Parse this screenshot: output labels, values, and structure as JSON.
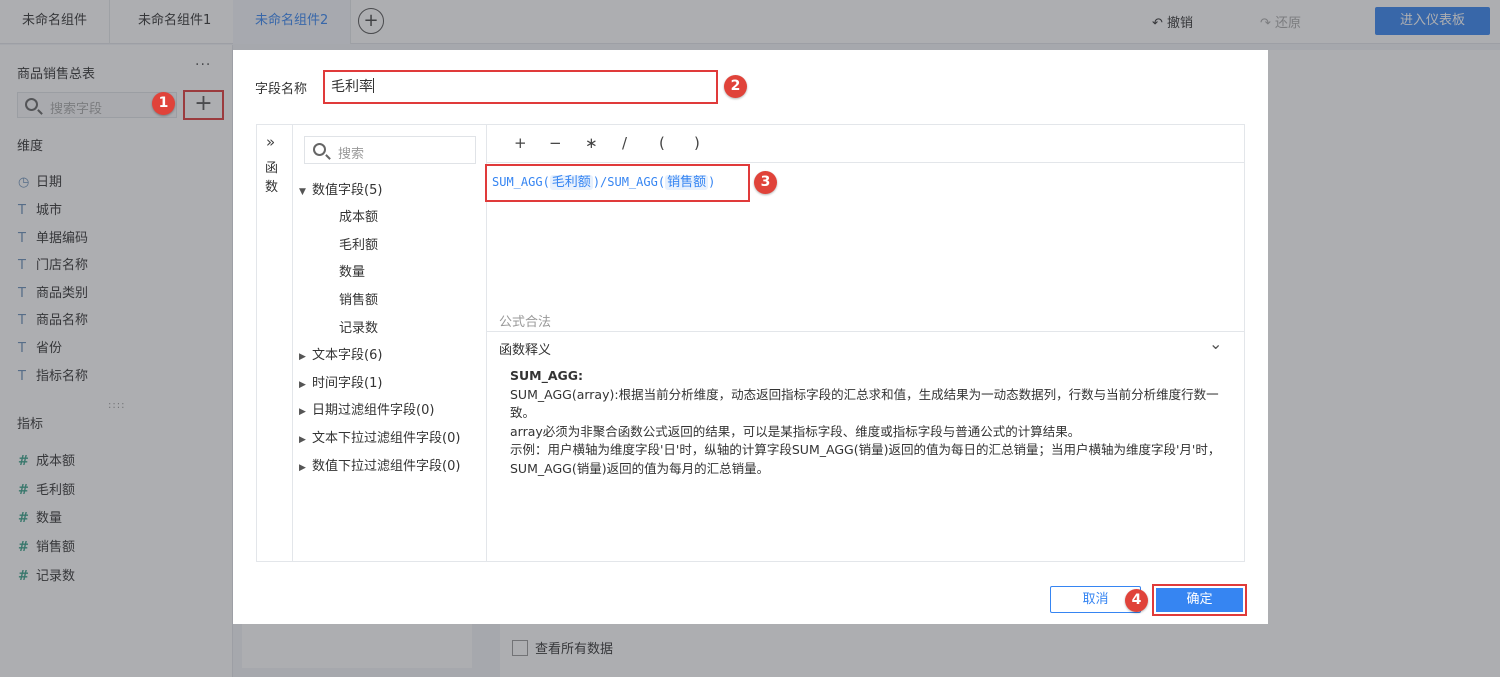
{
  "tabs": [
    "未命名组件",
    "未命名组件1",
    "未命名组件2"
  ],
  "toolbar": {
    "undo": "撤销",
    "redo": "还原",
    "enter_dashboard": "进入仪表板"
  },
  "sidebar": {
    "title": "商品销售总表",
    "more": "···",
    "search_placeholder": "搜索字段",
    "dimension_header": "维度",
    "dimensions": [
      {
        "icon": "clock-icon",
        "label": "日期"
      },
      {
        "icon": "text-icon",
        "label": "城市"
      },
      {
        "icon": "text-icon",
        "label": "单据编码"
      },
      {
        "icon": "text-icon",
        "label": "门店名称"
      },
      {
        "icon": "text-icon",
        "label": "商品类别"
      },
      {
        "icon": "text-icon",
        "label": "商品名称"
      },
      {
        "icon": "text-icon",
        "label": "省份"
      },
      {
        "icon": "text-icon",
        "label": "指标名称"
      }
    ],
    "measure_header": "指标",
    "measures": [
      {
        "icon": "hash-icon",
        "label": "成本额"
      },
      {
        "icon": "hash-icon",
        "label": "毛利额"
      },
      {
        "icon": "hash-icon",
        "label": "数量"
      },
      {
        "icon": "hash-icon",
        "label": "销售额"
      },
      {
        "icon": "hash-icon",
        "label": "记录数"
      }
    ]
  },
  "view_all": "查看所有数据",
  "dialog": {
    "field_name_label": "字段名称",
    "field_name_value": "毛利率",
    "function_toggle": "函数",
    "field_search_placeholder": "搜索",
    "tree": {
      "numeric": "数值字段(5)",
      "numeric_children": [
        "成本额",
        "毛利额",
        "数量",
        "销售额",
        "记录数"
      ],
      "text": "文本字段(6)",
      "time": "时间字段(1)",
      "date_filter": "日期过滤组件字段(0)",
      "text_dropdown": "文本下拉过滤组件字段(0)",
      "numeric_dropdown": "数值下拉过滤组件字段(0)"
    },
    "operators": [
      "+",
      "−",
      "∗",
      "/",
      "(",
      ")"
    ],
    "formula": {
      "fn1": "SUM_AGG(",
      "arg1": "毛利额",
      "sep": ")/SUM_AGG(",
      "arg2": "销售额",
      "end": ")"
    },
    "valid_text": "公式合法",
    "explain_header": "函数释义",
    "explain": {
      "name": "SUM_AGG:",
      "line1": "SUM_AGG(array):根据当前分析维度，动态返回指标字段的汇总求和值，生成结果为一动态数据列，行数与当前分析维度行数一致。",
      "line2": " array必须为非聚合函数公式返回的结果，可以是某指标字段、维度或指标字段与普通公式的计算结果。",
      "line3": " 示例：用户横轴为维度字段'日'时，纵轴的计算字段SUM_AGG(销量)返回的值为每日的汇总销量；当用户横轴为维度字段'月'时，SUM_AGG(销量)返回的值为每月的汇总销量。"
    },
    "cancel": "取消",
    "confirm": "确定"
  },
  "badges": [
    "1",
    "2",
    "3",
    "4"
  ],
  "colors": {
    "accent": "#3685f2",
    "highlight": "#e03a3a"
  }
}
